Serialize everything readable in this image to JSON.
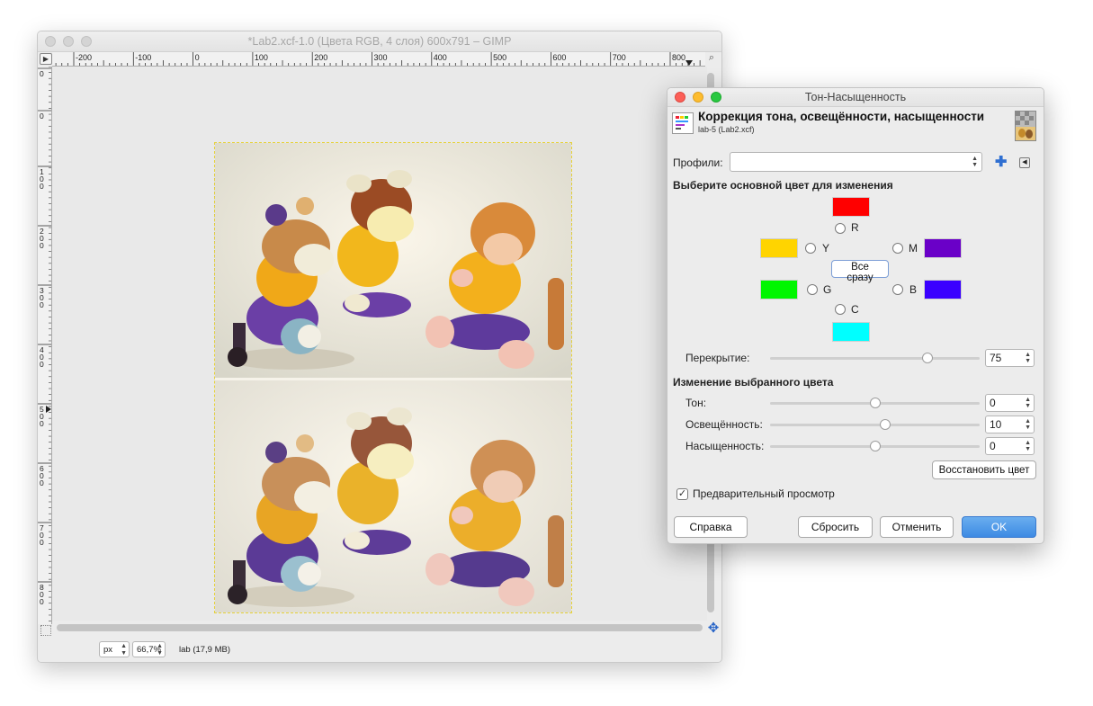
{
  "main_window": {
    "title": "*Lab2.xcf-1.0 (Цвета RGB, 4 слоя) 600x791 – GIMP",
    "ruler_top_labels": [
      "-200",
      "-100",
      "0",
      "100",
      "200",
      "300",
      "400",
      "500",
      "600",
      "700",
      "800"
    ],
    "ruler_left_labels": [
      "0",
      "0",
      "100",
      "200",
      "300",
      "400",
      "500",
      "600",
      "700",
      "800"
    ],
    "status": {
      "unit": "px",
      "zoom": "66,7%",
      "layer_info": "lab (17,9 MB)"
    }
  },
  "dialog": {
    "title": "Тон-Насыщенность",
    "header_title": "Коррекция тона, освещённости, насыщенности",
    "header_sub": "lab-5 (Lab2.xcf)",
    "profiles_label": "Профили:",
    "profiles_value": "",
    "primary_heading": "Выберите основной цвет для изменения",
    "colors": {
      "R": {
        "label": "R",
        "swatch": "#ff0000"
      },
      "Y": {
        "label": "Y",
        "swatch": "#ffd400"
      },
      "M": {
        "label": "M",
        "swatch": "#6a00c8"
      },
      "G": {
        "label": "G",
        "swatch": "#00f600"
      },
      "B": {
        "label": "B",
        "swatch": "#3a00ff"
      },
      "C": {
        "label": "C",
        "swatch": "#00ffff"
      }
    },
    "all_button": "Все сразу",
    "overlap": {
      "label": "Перекрытие:",
      "value": "75",
      "fraction": 0.75
    },
    "edit_heading": "Изменение выбранного цвета",
    "hue": {
      "label": "Тон:",
      "value": "0",
      "fraction": 0.5
    },
    "lightness": {
      "label": "Освещённость:",
      "value": "10",
      "fraction": 0.55
    },
    "saturation": {
      "label": "Насыщенность:",
      "value": "0",
      "fraction": 0.5
    },
    "reset_color_button": "Восстановить цвет",
    "preview": {
      "label": "Предварительный просмотр",
      "checked": true
    },
    "buttons": {
      "help": "Справка",
      "reset": "Сбросить",
      "cancel": "Отменить",
      "ok": "OK"
    }
  }
}
